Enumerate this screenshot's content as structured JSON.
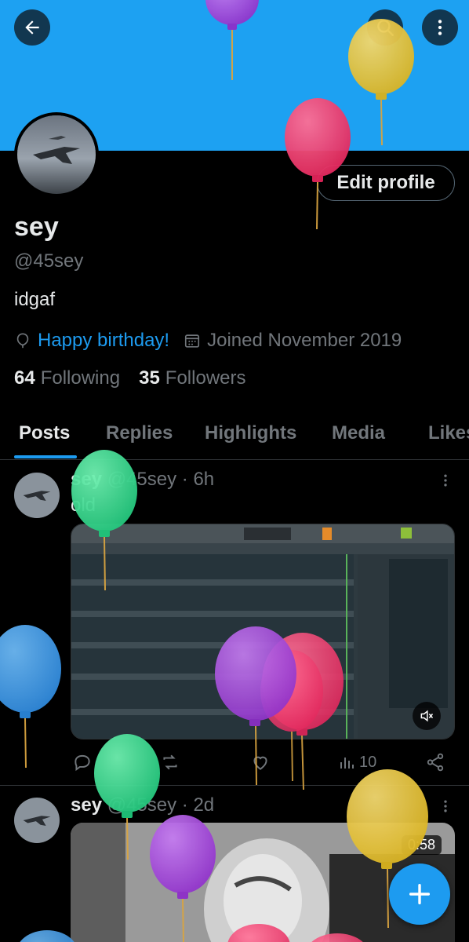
{
  "colors": {
    "banner": "#1da1f2",
    "accent": "#1d9bf0",
    "muted": "#71767b",
    "text": "#e7e9ea"
  },
  "header": {
    "icons": {
      "back": "arrow-left-icon",
      "search": "search-icon",
      "more": "more-vertical-icon"
    }
  },
  "profile": {
    "name": "sey",
    "handle": "@45sey",
    "bio": "idgaf",
    "birthday": "Happy birthday!",
    "joined": "Joined November 2019",
    "following_count": "64",
    "following_label": "Following",
    "followers_count": "35",
    "followers_label": "Followers",
    "edit_label": "Edit profile"
  },
  "tabs": [
    {
      "label": "Posts",
      "active": true
    },
    {
      "label": "Replies"
    },
    {
      "label": "Highlights"
    },
    {
      "label": "Media"
    },
    {
      "label": "Likes"
    }
  ],
  "posts": [
    {
      "name": "sey",
      "handle": "@45sey",
      "time": "· 6h",
      "text": "old",
      "media": "video",
      "views": "10"
    },
    {
      "name": "sey",
      "handle": "@45sey",
      "time": "· 2d",
      "media": "video",
      "duration": "0:58"
    }
  ],
  "fab_icon": "plus-icon"
}
